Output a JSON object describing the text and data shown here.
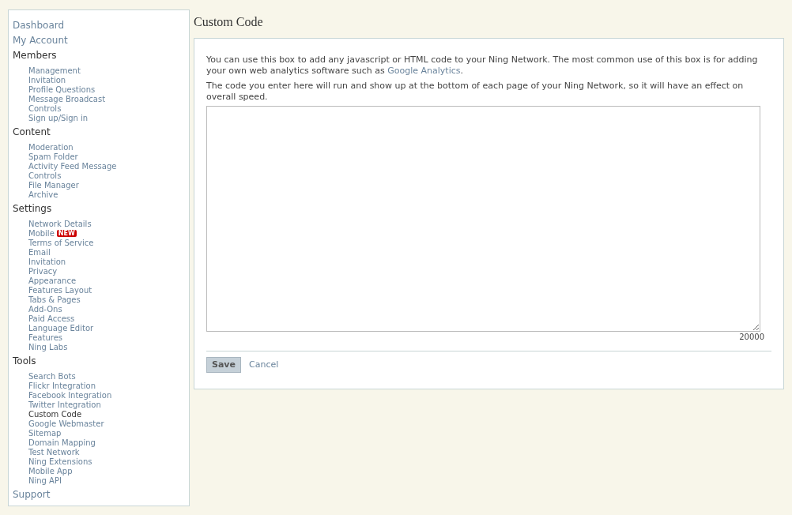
{
  "sidebar": {
    "sections": [
      {
        "label": "Dashboard",
        "kind": "link"
      },
      {
        "label": "My Account",
        "kind": "link"
      },
      {
        "label": "Members",
        "kind": "group",
        "children": [
          {
            "label": "Management",
            "selected": false
          },
          {
            "label": "Invitation",
            "selected": false
          },
          {
            "label": "Profile Questions",
            "selected": false
          },
          {
            "label": "Message Broadcast",
            "selected": false
          },
          {
            "label": "Controls",
            "selected": false
          },
          {
            "label": "Sign up/Sign in",
            "selected": false
          }
        ]
      },
      {
        "label": "Content",
        "kind": "group",
        "children": [
          {
            "label": "Moderation",
            "selected": false
          },
          {
            "label": "Spam Folder",
            "selected": false
          },
          {
            "label": "Activity Feed Message",
            "selected": false
          },
          {
            "label": "Controls",
            "selected": false
          },
          {
            "label": "File Manager",
            "selected": false
          },
          {
            "label": "Archive",
            "selected": false
          }
        ]
      },
      {
        "label": "Settings",
        "kind": "group",
        "children": [
          {
            "label": "Network Details",
            "selected": false
          },
          {
            "label": "Mobile",
            "selected": false,
            "badge": "NEW"
          },
          {
            "label": "Terms of Service",
            "selected": false
          },
          {
            "label": "Email",
            "selected": false
          },
          {
            "label": "Invitation",
            "selected": false
          },
          {
            "label": "Privacy",
            "selected": false
          },
          {
            "label": "Appearance",
            "selected": false
          },
          {
            "label": "Features Layout",
            "selected": false
          },
          {
            "label": "Tabs & Pages",
            "selected": false
          },
          {
            "label": "Add-Ons",
            "selected": false
          },
          {
            "label": "Paid Access",
            "selected": false
          },
          {
            "label": "Language Editor",
            "selected": false
          },
          {
            "label": "Features",
            "selected": false
          },
          {
            "label": "Ning Labs",
            "selected": false
          }
        ]
      },
      {
        "label": "Tools",
        "kind": "group",
        "children": [
          {
            "label": "Search Bots",
            "selected": false
          },
          {
            "label": "Flickr Integration",
            "selected": false
          },
          {
            "label": "Facebook Integration",
            "selected": false
          },
          {
            "label": "Twitter Integration",
            "selected": false
          },
          {
            "label": "Custom Code",
            "selected": true
          },
          {
            "label": "Google Webmaster",
            "selected": false
          },
          {
            "label": "Sitemap",
            "selected": false
          },
          {
            "label": "Domain Mapping",
            "selected": false
          },
          {
            "label": "Test Network",
            "selected": false
          },
          {
            "label": "Ning Extensions",
            "selected": false
          },
          {
            "label": "Mobile App",
            "selected": false
          },
          {
            "label": "Ning API",
            "selected": false
          }
        ]
      },
      {
        "label": "Support",
        "kind": "link"
      }
    ]
  },
  "page_title": "Custom Code",
  "intro": "You can use this box to add any javascript or HTML code to your Ning Network. The most common use of this box is for adding your own web analytics software such as ",
  "intro_link": "Google Analytics",
  "intro_end": ".",
  "note": "The code you enter here will run and show up at the bottom of each page of your Ning Network, so it will have an effect on overall speed.",
  "char_count": "20000",
  "buttons": {
    "save": "Save",
    "cancel": "Cancel"
  }
}
